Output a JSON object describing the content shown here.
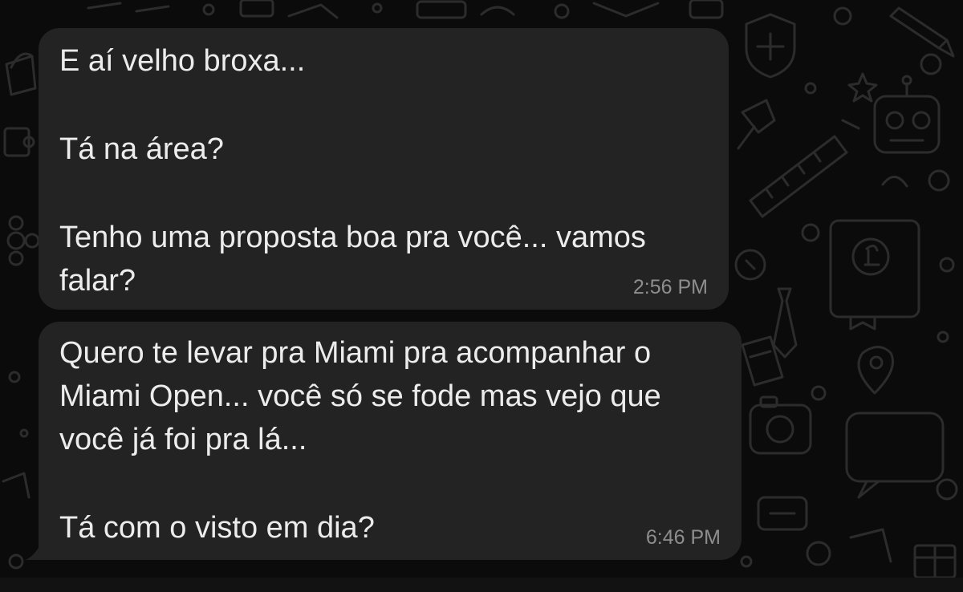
{
  "chat": {
    "messages": [
      {
        "lines": [
          "E aí velho broxa...",
          "Tá na área?",
          "Tenho uma proposta boa pra você... vamos",
          "falar?"
        ],
        "time": "2:56 PM"
      },
      {
        "lines": [
          "Quero te levar pra Miami pra acompanhar o",
          "Miami Open... você só se fode mas vejo que",
          "você já foi pra lá...",
          "Tá com o visto em dia?"
        ],
        "time": "6:46 PM"
      }
    ]
  },
  "colors": {
    "background": "#0b0b0b",
    "bubble": "#232323",
    "text": "#ececec",
    "timestamp": "#8e8e8e",
    "doodle": "#2c2c2c"
  },
  "icons": [
    "shield-plus-icon",
    "pencil-icon",
    "robot-icon",
    "ruler-icon",
    "star-icon",
    "pushpin-icon",
    "book-pound-icon",
    "necktie-icon",
    "location-pin-icon",
    "ticket-icon",
    "bucket-icon",
    "camera-icon",
    "chat-bubble-icon",
    "gift-icon",
    "puzzle-icon",
    "flower-icon"
  ]
}
